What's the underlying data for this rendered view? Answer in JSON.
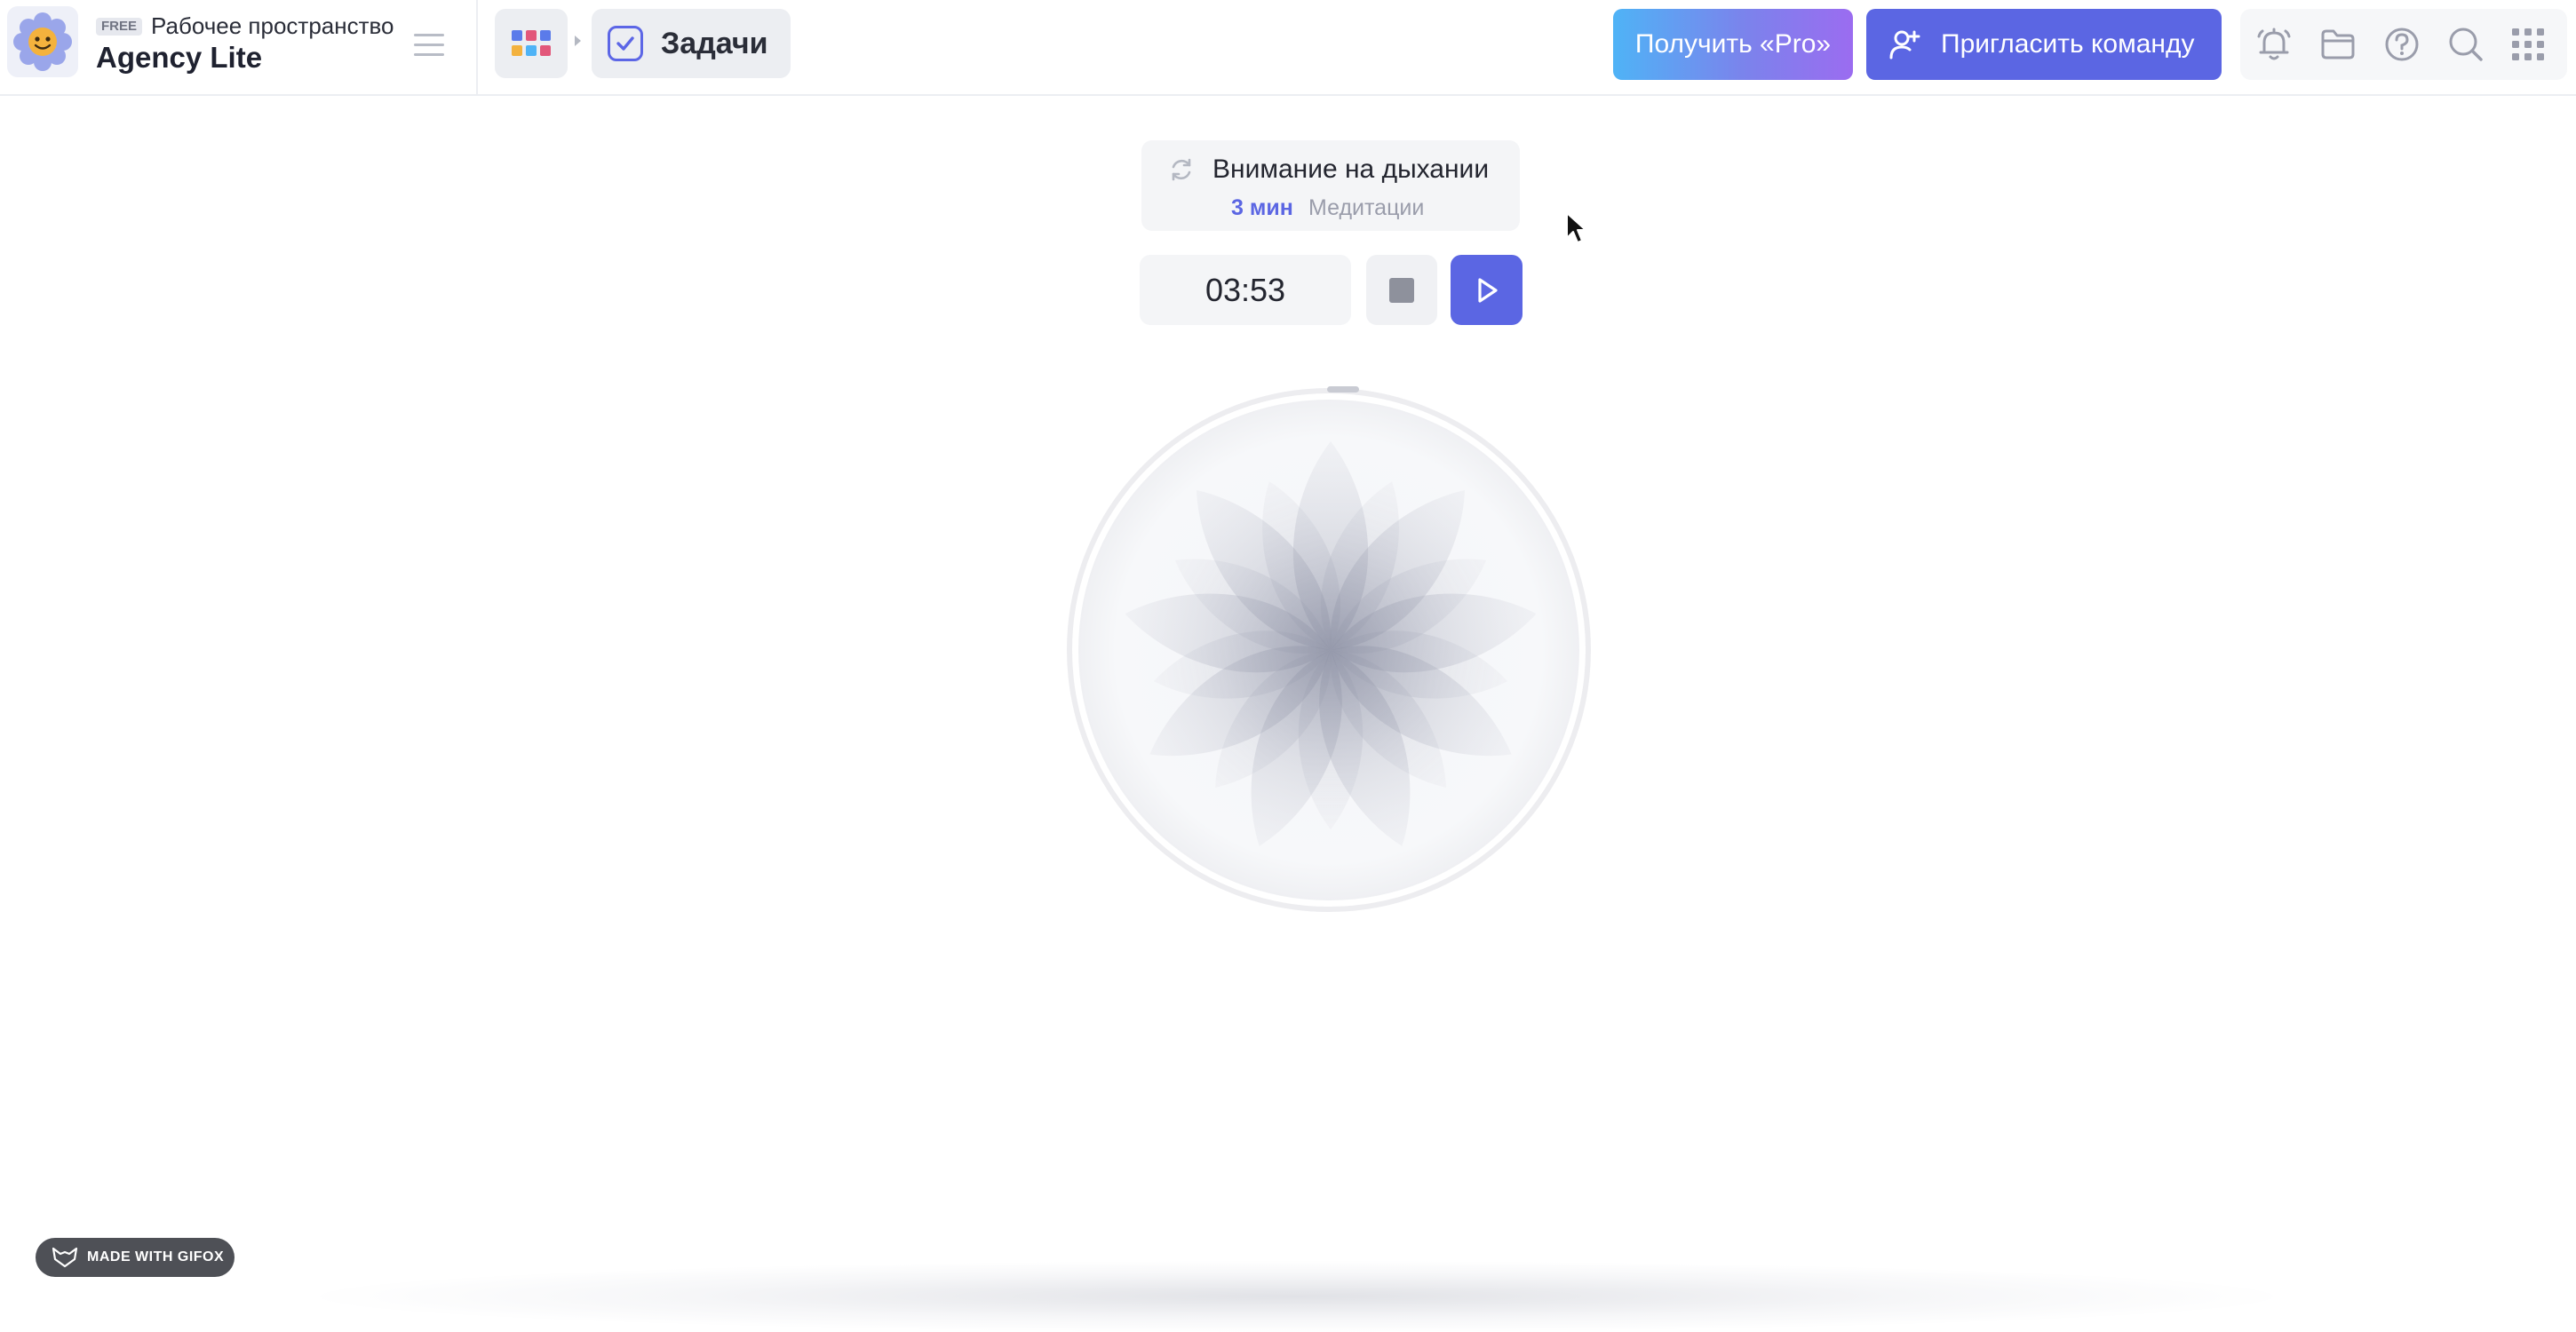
{
  "workspace": {
    "plan_badge": "FREE",
    "label": "Рабочее пространство",
    "name": "Agency Lite"
  },
  "breadcrumb": {
    "current_tab": "Задачи"
  },
  "header": {
    "pro_button": "Получить «Pro»",
    "invite_button": "Пригласить команду",
    "icons": [
      "bell-icon",
      "folder-icon",
      "help-icon",
      "search-icon",
      "grid-apps-icon"
    ]
  },
  "session": {
    "title": "Внимание на дыхании",
    "duration": "3 мин",
    "category": "Медитации",
    "timer": "03:53"
  },
  "footer": {
    "watermark": "MADE WITH GIFOX"
  },
  "colors": {
    "accent": "#5b66e3",
    "pro_gradient_start": "#4fb3f6",
    "pro_gradient_end": "#9b6cf0"
  }
}
